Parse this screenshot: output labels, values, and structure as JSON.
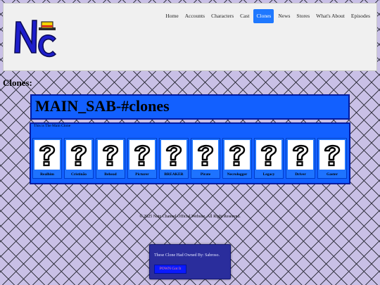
{
  "nav": {
    "items": [
      "Home",
      "Accounts",
      "Characters",
      "Cast",
      "Clones",
      "News",
      "Stores",
      "What's About",
      "Episodes"
    ],
    "active": "Clones"
  },
  "section_title": "Clones:",
  "clone": {
    "name": "MAIN_SAB-#clones",
    "caption": "This is The Main Clone",
    "cards": [
      "Realhim",
      "Cristinão",
      "Behead",
      "Picturer",
      "BREAKER",
      "Pirate",
      "Necrologger",
      "Legacy",
      "Driver",
      "Gaster"
    ]
  },
  "footer": "© 2025 Natz Channel Official Website. All Right Reserved.",
  "owner": {
    "text": "These Clone Had Owned By: Sabroso.",
    "button": "POWN Got It"
  },
  "colors": {
    "accent": "#1f78ff",
    "panel": "#1260ff",
    "owner_box": "#2a2d9c"
  }
}
